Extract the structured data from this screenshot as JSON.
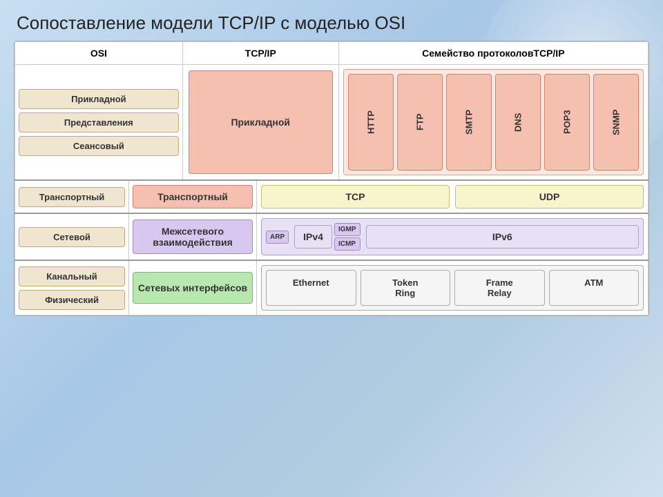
{
  "title": "Сопоставление модели TCP/IP с моделью OSI",
  "headers": {
    "osi": "OSI",
    "tcpip": "TCP/IP",
    "protocols": "Семейство протоколовTCP/IP"
  },
  "osi_layers": {
    "app": "Прикладной",
    "presentation": "Представления",
    "session": "Сеансовый",
    "transport": "Транспортный",
    "network": "Сетевой",
    "datalink": "Канальный",
    "physical": "Физический"
  },
  "tcpip_layers": {
    "application": "Прикладной",
    "transport": "Транспортный",
    "internet": "Межсетевого взаимодействия",
    "network_access": "Сетевых интерфейсов"
  },
  "app_protocols": [
    "HTTP",
    "FTP",
    "SMTP",
    "DNS",
    "POP3",
    "SNMP"
  ],
  "transport_protocols": [
    "TCP",
    "UDP"
  ],
  "network_protocols": {
    "small": [
      "ARP",
      "IGMP",
      "ICMP"
    ],
    "main": [
      "IPv4",
      "IPv6"
    ]
  },
  "link_protocols": [
    "Ethernet",
    "Token Ring",
    "Frame Relay",
    "ATM"
  ]
}
